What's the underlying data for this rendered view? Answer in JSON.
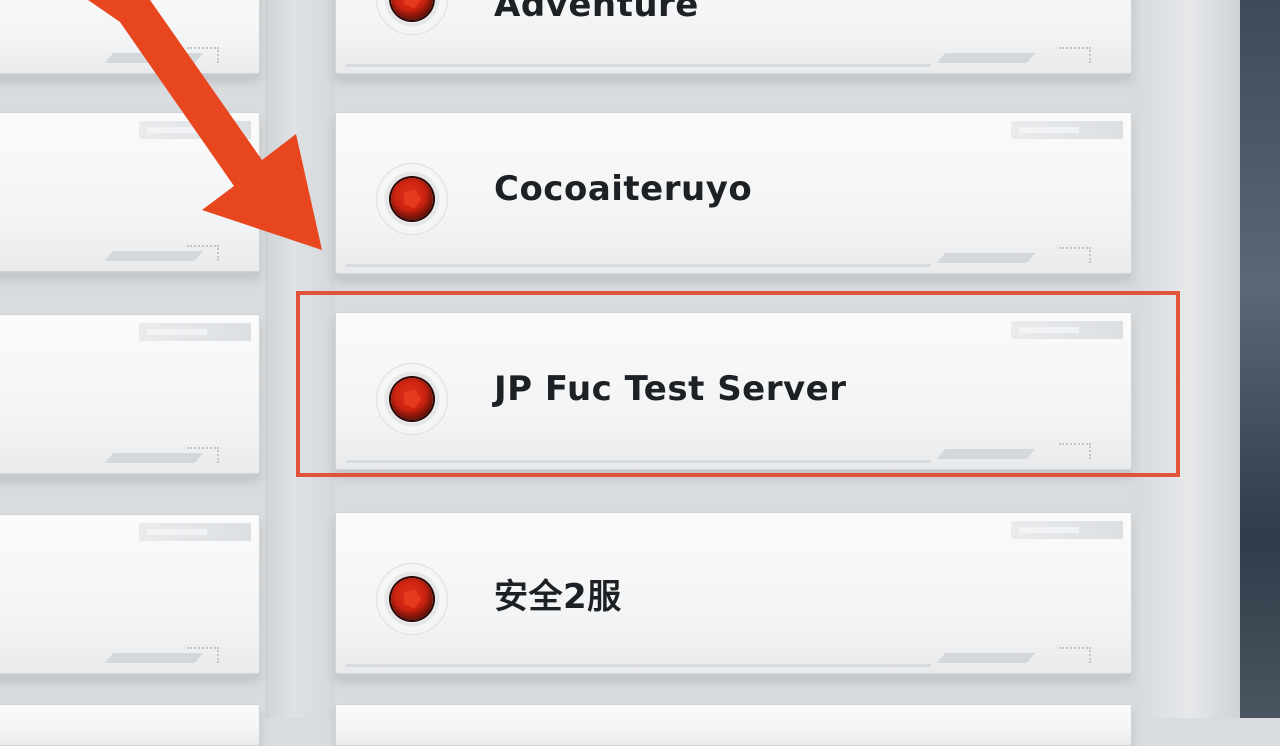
{
  "server_list": {
    "items": [
      {
        "name": "Adventure",
        "selected": false
      },
      {
        "name": "Cocoaiteruyo",
        "selected": false
      },
      {
        "name": "JP Fuc Test Server",
        "selected": true
      },
      {
        "name": "安全2服",
        "selected": false
      }
    ]
  },
  "annotation": {
    "arrow_color": "#e8461f",
    "highlight_color": "#e2533a"
  },
  "emblem_icon": "red-pentagon-emblem-icon"
}
